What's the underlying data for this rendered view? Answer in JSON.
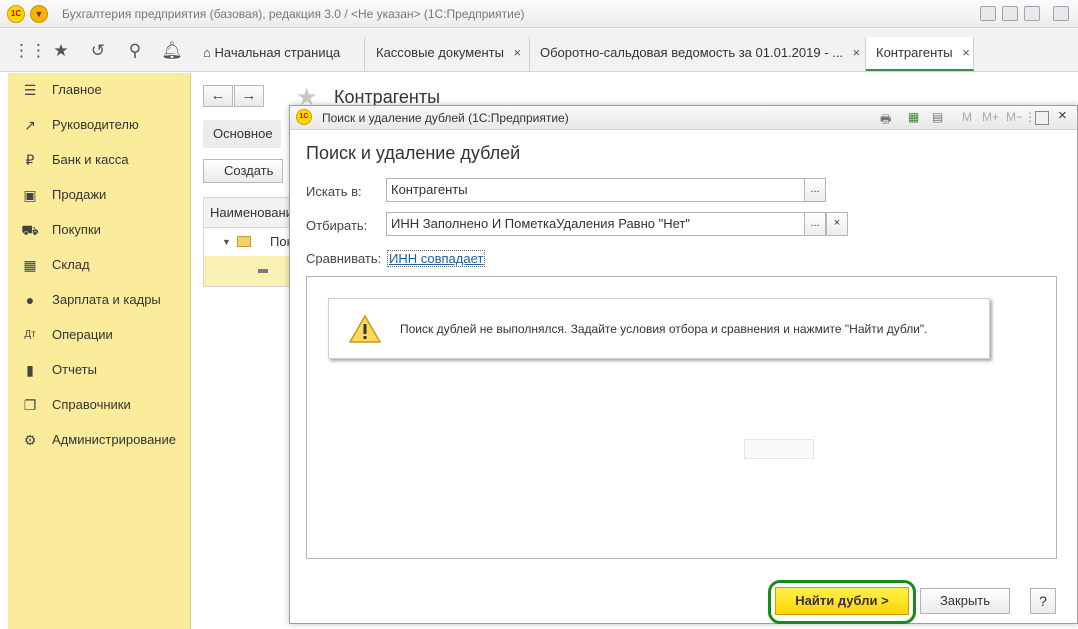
{
  "window": {
    "logo_text": "1С",
    "title": "Бухгалтерия предприятия (базовая), редакция 3.0 / <Не указан>  (1С:Предприятие)"
  },
  "toolbar": {
    "icons": [
      "apps-grid-icon",
      "star-icon",
      "history-icon",
      "search-icon",
      "bell-icon"
    ]
  },
  "tabs": [
    {
      "label": "Начальная страница",
      "icon": "home-icon"
    },
    {
      "label": "Кассовые документы",
      "close": "×"
    },
    {
      "label": "Оборотно-сальдовая ведомость за 01.01.2019 - ...",
      "close": "×"
    },
    {
      "label": "Контрагенты",
      "close": "×",
      "active": true
    }
  ],
  "sidebar": {
    "items": [
      {
        "label": "Главное",
        "icon": "menu-icon",
        "glyph": "☰"
      },
      {
        "label": "Руководителю",
        "icon": "trend-up-icon",
        "glyph": "↗"
      },
      {
        "label": "Банк и касса",
        "icon": "ruble-icon",
        "glyph": "₽"
      },
      {
        "label": "Продажи",
        "icon": "shopping-bag-icon",
        "glyph": "▣"
      },
      {
        "label": "Покупки",
        "icon": "cart-icon",
        "glyph": "⛟"
      },
      {
        "label": "Склад",
        "icon": "warehouse-icon",
        "glyph": "▦"
      },
      {
        "label": "Зарплата и кадры",
        "icon": "person-icon",
        "glyph": "●"
      },
      {
        "label": "Операции",
        "icon": "dt-kt-icon",
        "glyph": "Дт"
      },
      {
        "label": "Отчеты",
        "icon": "bar-chart-icon",
        "glyph": "▮"
      },
      {
        "label": "Справочники",
        "icon": "book-icon",
        "glyph": "❐"
      },
      {
        "label": "Администрирование",
        "icon": "gear-icon",
        "glyph": "⚙"
      }
    ]
  },
  "background_form": {
    "title": "Контрагенты",
    "back": "←",
    "forward": "→",
    "main_tab": "Основное",
    "create_button": "Создать",
    "column_header": "Наименование",
    "row_1": "Пок"
  },
  "modal": {
    "header_logo": "1С",
    "header_title": "Поиск и удаление дублей  (1С:Предприятие)",
    "header_icons": {
      "m": "M",
      "m_plus": "M+",
      "m_minus": "M−",
      "more": "⋮",
      "close": "×"
    },
    "title": "Поиск и удаление дублей",
    "search_in_label": "Искать в:",
    "search_in_value": "Контрагенты",
    "filter_label": "Отбирать:",
    "filter_value": "ИНН Заполнено И ПометкаУдаления Равно \"Нет\"",
    "compare_label": "Сравнивать:",
    "compare_link": "ИНН совпадает",
    "select_button": "...",
    "clear_button": "×",
    "message": "Поиск дублей не выполнялся.  Задайте условия отбора и сравнения и нажмите \"Найти дубли\".",
    "find_button": "Найти дубли >",
    "close_button": "Закрыть",
    "help_button": "?"
  },
  "colors": {
    "sidebar_bg": "#fbec9c",
    "accent_yellow": "#ffd400",
    "highlight_green": "#1a8a1a",
    "link_blue": "#1f5e9e"
  }
}
